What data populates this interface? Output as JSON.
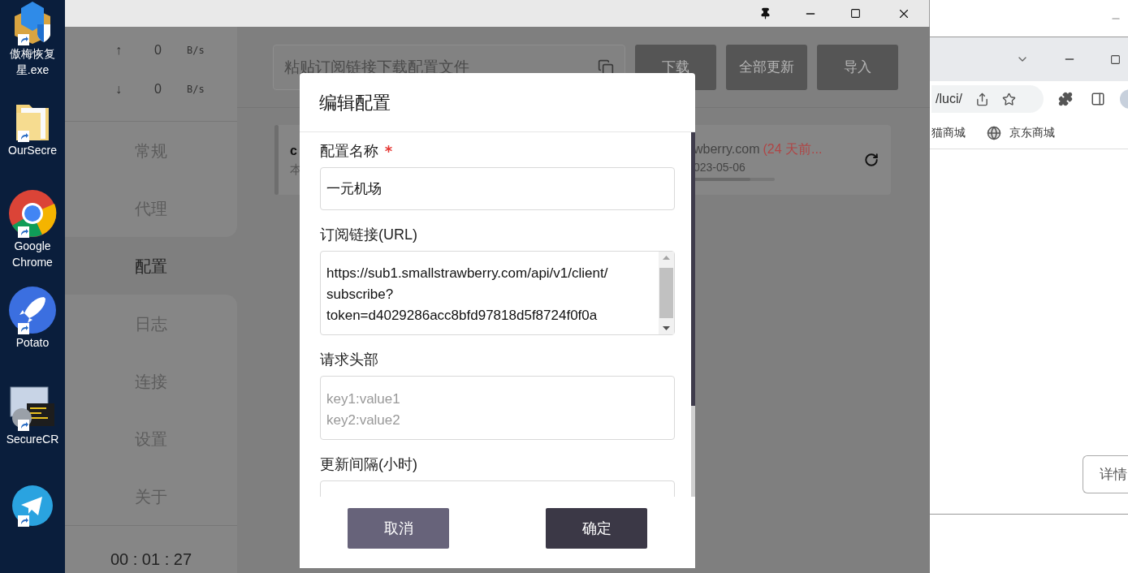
{
  "desktop_icons": [
    {
      "label_lines": [
        "傲梅恢复",
        "星.exe"
      ]
    },
    {
      "label_lines": [
        "OurSecre"
      ]
    },
    {
      "label_lines": [
        "Google",
        "Chrome"
      ]
    },
    {
      "label_lines": [
        "Potato"
      ]
    },
    {
      "label_lines": [
        "SecureCR"
      ]
    }
  ],
  "speed": [
    {
      "arrow": "↑",
      "value": "0",
      "unit": "B/s"
    },
    {
      "arrow": "↓",
      "value": "0",
      "unit": "B/s"
    }
  ],
  "sidebar": {
    "items": [
      {
        "label": "常规",
        "selected": false
      },
      {
        "label": "代理",
        "selected": false
      },
      {
        "label": "配置",
        "selected": true
      },
      {
        "label": "日志",
        "selected": false
      },
      {
        "label": "连接",
        "selected": false
      },
      {
        "label": "设置",
        "selected": false
      },
      {
        "label": "关于",
        "selected": false
      }
    ],
    "timer": "00 : 01 : 27"
  },
  "toolbar": {
    "placeholder": "粘贴订阅链接下载配置文件",
    "buttons": [
      "下载",
      "全部更新",
      "导入"
    ]
  },
  "profile_card": {
    "name": "c",
    "description": "本",
    "url": "wberry.com",
    "age": "(24 天前...",
    "date": "023-05-06",
    "level": 0.7
  },
  "dialog": {
    "title": "编辑配置",
    "fields": [
      {
        "kind": "input",
        "label": "配置名称",
        "required": true,
        "value_lines": [
          "一元机场"
        ]
      },
      {
        "kind": "textarea",
        "label": "订阅链接(URL)",
        "required": false,
        "value_lines": [
          "https://sub1.smallstrawberry.com/api/v1/client/",
          "subscribe?",
          "token=d4029286acc8bfd97818d5f8724f0f0a"
        ]
      },
      {
        "kind": "textarea",
        "label": "请求头部",
        "required": false,
        "placeholder_lines": [
          "key1:value1",
          "key2:value2"
        ]
      },
      {
        "kind": "input",
        "label": "更新间隔(小时)",
        "required": false
      }
    ],
    "buttons": [
      {
        "label": "取消",
        "kind": "secondary"
      },
      {
        "label": "确定",
        "kind": "primary"
      }
    ]
  },
  "browser": {
    "address": "/luci/",
    "bookmarks": [
      "猫商城",
      "京东商城"
    ],
    "details_button": "详情"
  }
}
